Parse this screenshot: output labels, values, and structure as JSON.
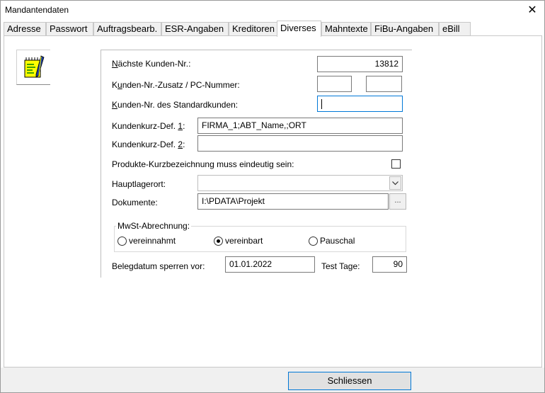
{
  "window": {
    "title": "Mandantendaten",
    "close_label": "✕"
  },
  "tabs": [
    {
      "label": "Adresse"
    },
    {
      "label": "Passwort"
    },
    {
      "label": "Auftragsbearb."
    },
    {
      "label": "ESR-Angaben"
    },
    {
      "label": "Kreditoren"
    },
    {
      "label": "Diverses",
      "active": true
    },
    {
      "label": "Mahntexte"
    },
    {
      "label": "FiBu-Angaben"
    },
    {
      "label": "eBill"
    }
  ],
  "form": {
    "next_customer_no": {
      "label_accel": "N",
      "label_rest": "ächste Kunden-Nr.:",
      "value": "13812"
    },
    "customer_suffix": {
      "label_pre": "K",
      "label_accel": "u",
      "label_rest": "nden-Nr.-Zusatz / PC-Nummer:",
      "value1": "",
      "value2": ""
    },
    "standard_customer": {
      "label_accel": "K",
      "label_rest": "unden-Nr. des Standardkunden:",
      "value": ""
    },
    "short_def_1": {
      "label_pre": "Kundenkurz-Def. ",
      "label_accel": "1",
      "label_rest": ":",
      "value": "FIRMA_1;ABT_Name,;ORT"
    },
    "short_def_2": {
      "label_pre": "Kundenkurz-Def. ",
      "label_accel": "2",
      "label_rest": ":",
      "value": ""
    },
    "unique_short_desc": {
      "label": "Produkte-Kurzbezeichnung muss eindeutig sein:",
      "checked": false
    },
    "main_storage": {
      "label": "Hauptlagerort:",
      "value": ""
    },
    "documents": {
      "label": "Dokumente:",
      "value": "I:\\PDATA\\Projekt",
      "browse_label": "..."
    },
    "vat": {
      "legend": "MwSt-Abrechnung:",
      "options": [
        {
          "label": "vereinnahmt",
          "checked": false
        },
        {
          "label": "vereinbart",
          "checked": true
        },
        {
          "label": "Pauschal",
          "checked": false
        }
      ]
    },
    "lock_date": {
      "label": "Belegdatum sperren vor:",
      "value": "01.01.2022"
    },
    "test_days": {
      "label": "Test Tage:",
      "value": "90"
    }
  },
  "footer": {
    "close_button": "Schliessen"
  },
  "colors": {
    "focus": "#0078d7",
    "icon_yellow": "#ffff00",
    "icon_green": "#008000"
  }
}
